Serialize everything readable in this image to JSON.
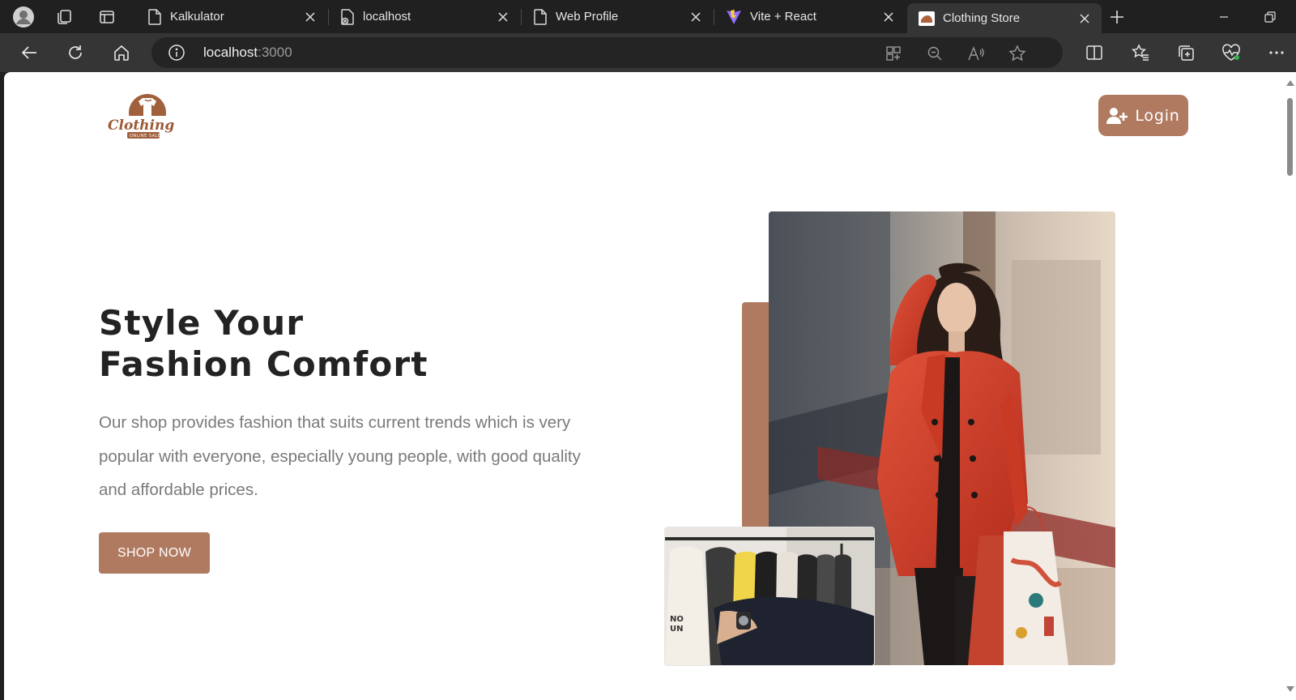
{
  "browser": {
    "tabs": [
      {
        "title": "Kalkulator",
        "icon": "page-icon"
      },
      {
        "title": "localhost",
        "icon": "page-error-icon"
      },
      {
        "title": "Web Profile",
        "icon": "page-icon"
      },
      {
        "title": "Vite + React",
        "icon": "vite-icon"
      },
      {
        "title": "Clothing Store",
        "icon": "store-favicon",
        "active": true
      }
    ],
    "address": {
      "host": "localhost",
      "port": ":3000"
    }
  },
  "site": {
    "logo": {
      "name": "Clothing",
      "tagline": "ONLINE SALE"
    },
    "login_label": "Login",
    "hero": {
      "title_line1": "Style Your",
      "title_line2": "Fashion Comfort",
      "description": "Our shop provides fashion that suits current trends which is very popular with everyone, especially young people, with good quality and affordable prices.",
      "cta_label": "SHOP NOW"
    },
    "colors": {
      "accent": "#b07a60",
      "heading": "#232323",
      "body_text": "#7a7a7a"
    }
  }
}
